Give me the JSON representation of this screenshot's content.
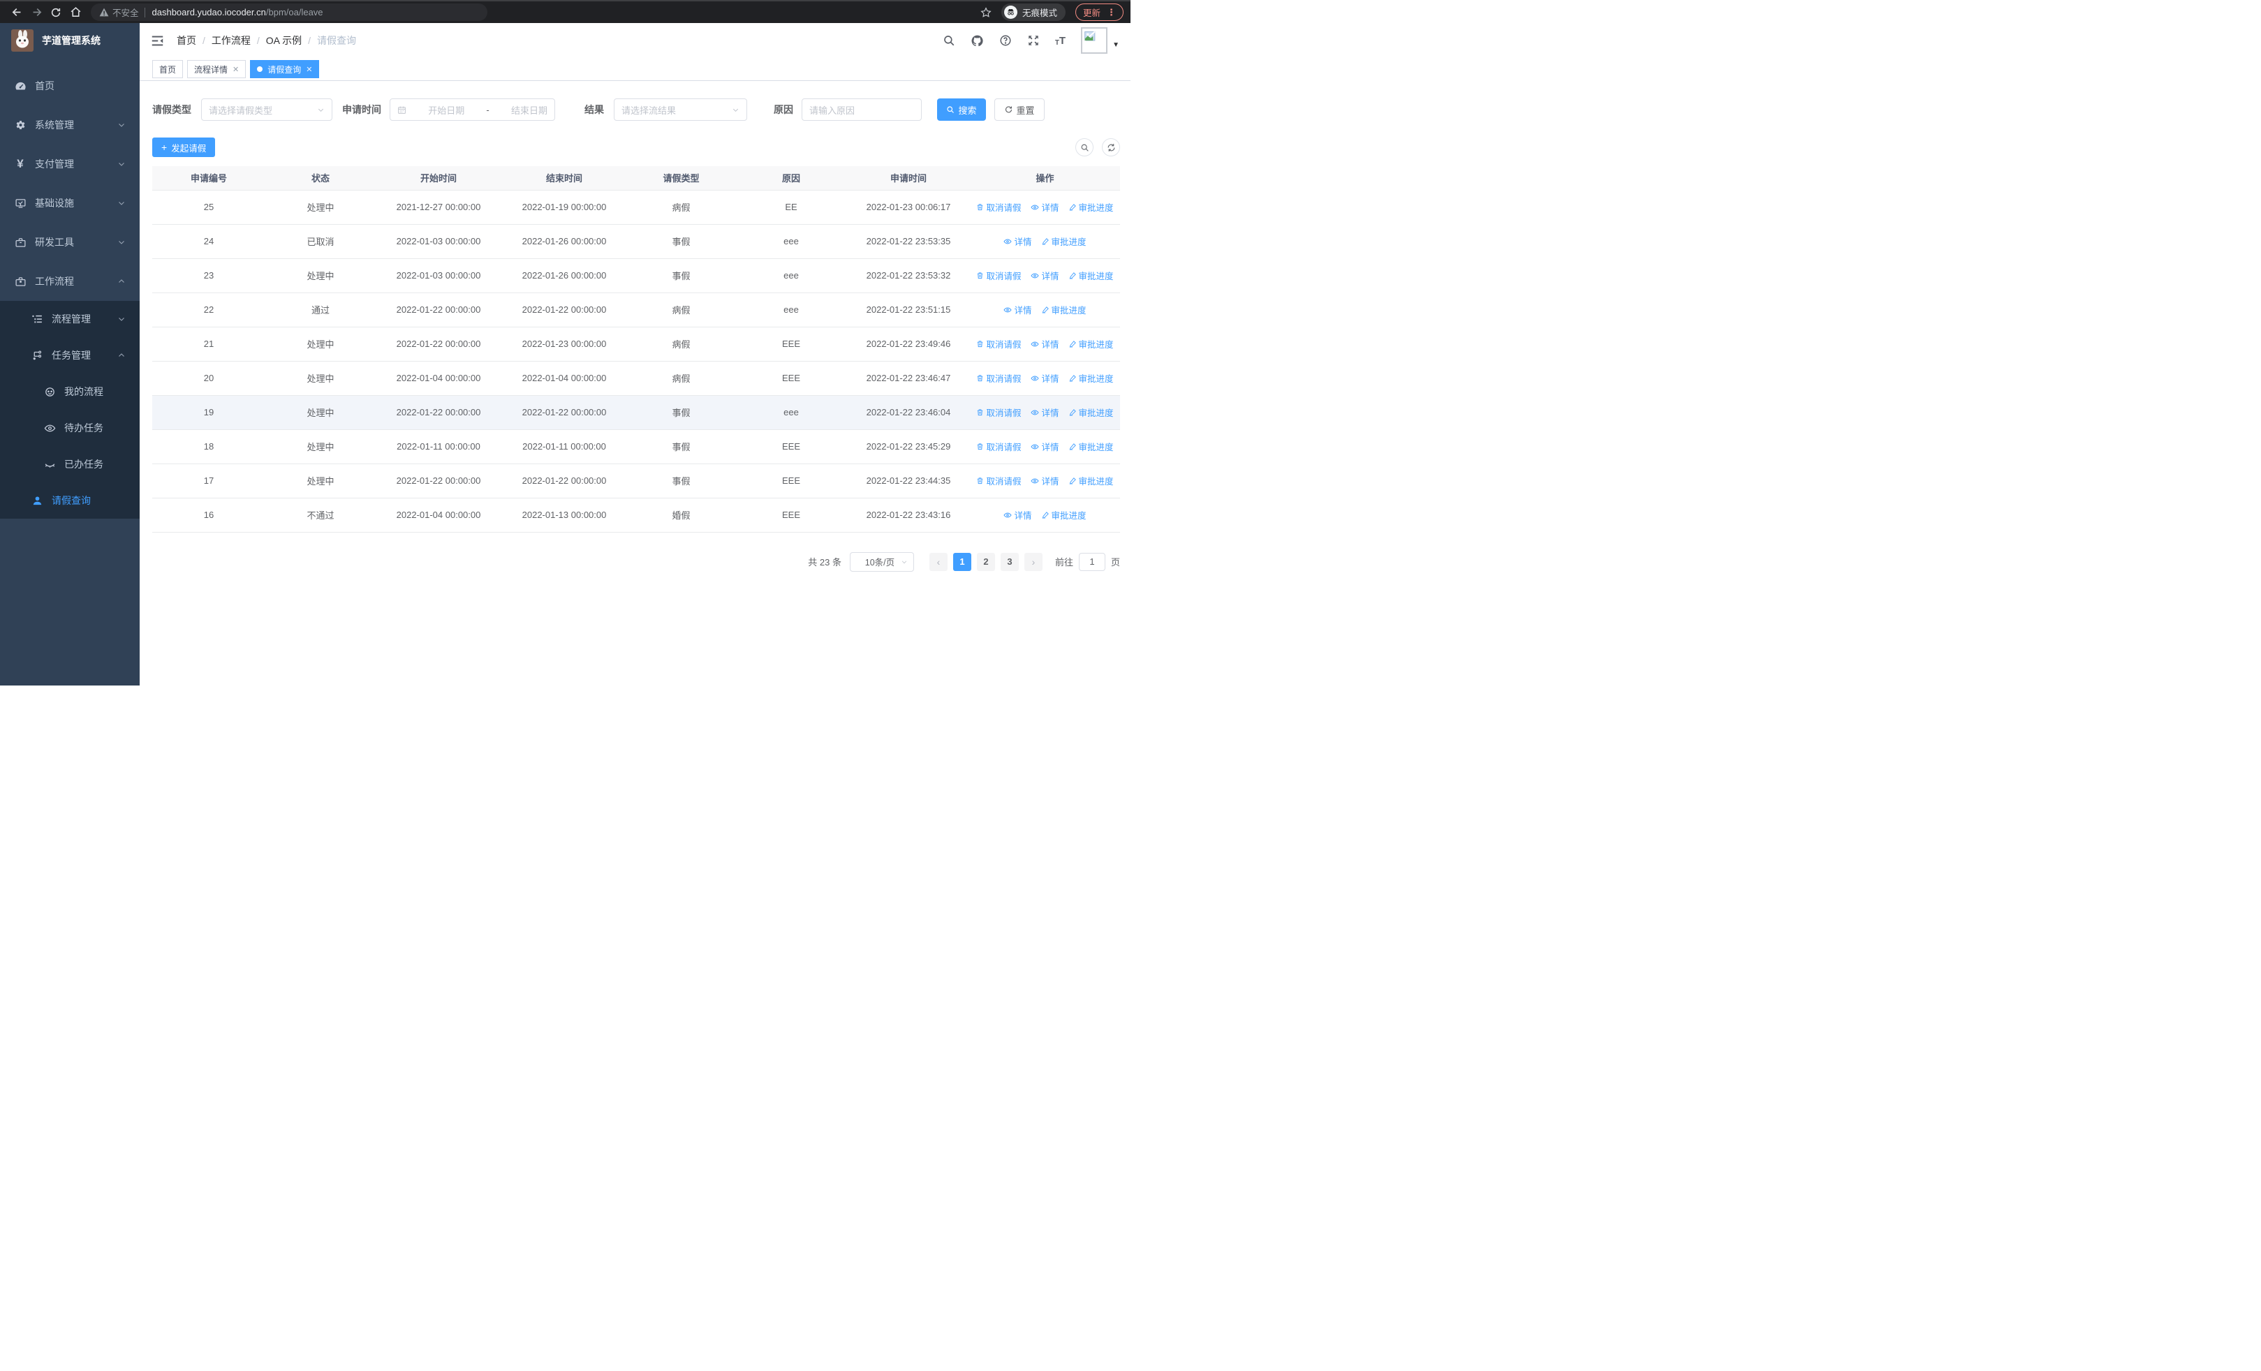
{
  "browser": {
    "not_secure_label": "不安全",
    "url_host": "dashboard.yudao.iocoder.cn",
    "url_path": "/bpm/oa/leave",
    "incognito_label": "无痕模式",
    "update_label": "更新"
  },
  "sidebar": {
    "logo_title": "芋道管理系统",
    "home": "首页",
    "system": "系统管理",
    "pay": "支付管理",
    "infra": "基础设施",
    "dev": "研发工具",
    "workflow": "工作流程",
    "process_mgmt": "流程管理",
    "task_mgmt": "任务管理",
    "my_process": "我的流程",
    "todo_task": "待办任务",
    "done_task": "已办任务",
    "leave_query": "请假查询"
  },
  "header": {
    "breadcrumb": [
      "首页",
      "工作流程",
      "OA 示例",
      "请假查询"
    ]
  },
  "tabs": [
    {
      "label": "首页",
      "closable": false,
      "active": false
    },
    {
      "label": "流程详情",
      "closable": true,
      "active": false
    },
    {
      "label": "请假查询",
      "closable": true,
      "active": true
    }
  ],
  "filters": {
    "type_label": "请假类型",
    "type_placeholder": "请选择请假类型",
    "time_label": "申请时间",
    "start_placeholder": "开始日期",
    "range_separator": "-",
    "end_placeholder": "结束日期",
    "result_label": "结果",
    "result_placeholder": "请选择流结果",
    "reason_label": "原因",
    "reason_placeholder": "请输入原因",
    "search_label": "搜索",
    "reset_label": "重置"
  },
  "toolbar": {
    "create_label": "发起请假"
  },
  "table": {
    "columns": [
      "申请编号",
      "状态",
      "开始时间",
      "结束时间",
      "请假类型",
      "原因",
      "申请时间",
      "操作"
    ],
    "action_labels": {
      "cancel": "取消请假",
      "detail": "详情",
      "progress": "审批进度"
    },
    "rows": [
      {
        "id": "25",
        "status": "处理中",
        "start": "2021-12-27 00:00:00",
        "end": "2022-01-19 00:00:00",
        "type": "病假",
        "reason": "EE",
        "apply_time": "2022-01-23 00:06:17",
        "can_cancel": true,
        "highlighted": false
      },
      {
        "id": "24",
        "status": "已取消",
        "start": "2022-01-03 00:00:00",
        "end": "2022-01-26 00:00:00",
        "type": "事假",
        "reason": "eee",
        "apply_time": "2022-01-22 23:53:35",
        "can_cancel": false,
        "highlighted": false
      },
      {
        "id": "23",
        "status": "处理中",
        "start": "2022-01-03 00:00:00",
        "end": "2022-01-26 00:00:00",
        "type": "事假",
        "reason": "eee",
        "apply_time": "2022-01-22 23:53:32",
        "can_cancel": true,
        "highlighted": false
      },
      {
        "id": "22",
        "status": "通过",
        "start": "2022-01-22 00:00:00",
        "end": "2022-01-22 00:00:00",
        "type": "病假",
        "reason": "eee",
        "apply_time": "2022-01-22 23:51:15",
        "can_cancel": false,
        "highlighted": false
      },
      {
        "id": "21",
        "status": "处理中",
        "start": "2022-01-22 00:00:00",
        "end": "2022-01-23 00:00:00",
        "type": "病假",
        "reason": "EEE",
        "apply_time": "2022-01-22 23:49:46",
        "can_cancel": true,
        "highlighted": false
      },
      {
        "id": "20",
        "status": "处理中",
        "start": "2022-01-04 00:00:00",
        "end": "2022-01-04 00:00:00",
        "type": "病假",
        "reason": "EEE",
        "apply_time": "2022-01-22 23:46:47",
        "can_cancel": true,
        "highlighted": false
      },
      {
        "id": "19",
        "status": "处理中",
        "start": "2022-01-22 00:00:00",
        "end": "2022-01-22 00:00:00",
        "type": "事假",
        "reason": "eee",
        "apply_time": "2022-01-22 23:46:04",
        "can_cancel": true,
        "highlighted": true
      },
      {
        "id": "18",
        "status": "处理中",
        "start": "2022-01-11 00:00:00",
        "end": "2022-01-11 00:00:00",
        "type": "事假",
        "reason": "EEE",
        "apply_time": "2022-01-22 23:45:29",
        "can_cancel": true,
        "highlighted": false
      },
      {
        "id": "17",
        "status": "处理中",
        "start": "2022-01-22 00:00:00",
        "end": "2022-01-22 00:00:00",
        "type": "事假",
        "reason": "EEE",
        "apply_time": "2022-01-22 23:44:35",
        "can_cancel": true,
        "highlighted": false
      },
      {
        "id": "16",
        "status": "不通过",
        "start": "2022-01-04 00:00:00",
        "end": "2022-01-13 00:00:00",
        "type": "婚假",
        "reason": "EEE",
        "apply_time": "2022-01-22 23:43:16",
        "can_cancel": false,
        "highlighted": false
      }
    ]
  },
  "pagination": {
    "total_label": "共 23 条",
    "page_size_label": "10条/页",
    "pages": [
      "1",
      "2",
      "3"
    ],
    "active_index": 0,
    "goto_label": "前往",
    "goto_value": "1",
    "page_unit_label": "页"
  },
  "icons": {
    "more_vertical": "⋮",
    "help_glyph": "?",
    "plus_glyph": "+",
    "caret_down": "▼",
    "prev_arrow": "‹",
    "next_arrow": "›",
    "yen_glyph": "¥"
  },
  "colors": {
    "primary": "#409eff",
    "sidebar_bg": "#304156",
    "submenu_bg": "#1f2d3d",
    "active_tab_bg": "#409eff",
    "table_header_bg": "#f8f8f9",
    "update_accent": "#f28b82",
    "browser_bar_bg": "#202124"
  }
}
